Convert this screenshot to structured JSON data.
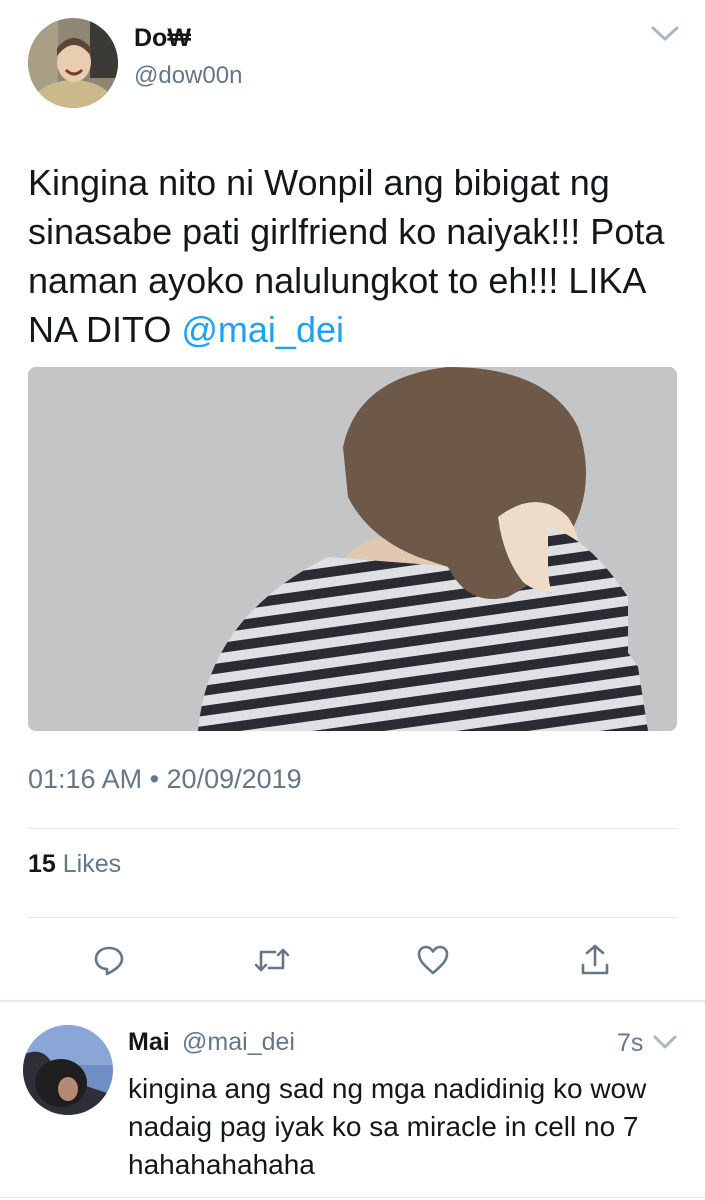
{
  "tweet": {
    "display_name": "Do₩",
    "handle": "@dow00n",
    "text_before_mention": "Kingina nito ni Wonpil ang bibigat ng sinasabe pati girlfriend ko naiyak!!! Pota naman ayoko nalulungkot to eh!!! LIKA NA DITO ",
    "mention": "@mai_dei",
    "timestamp": "01:16 AM • 20/09/2019",
    "likes_count": "15",
    "likes_label": " Likes",
    "icons": [
      "chevron-down-icon",
      "reply-icon",
      "retweet-icon",
      "heart-icon",
      "share-icon"
    ]
  },
  "reply": {
    "display_name": "Mai",
    "handle": "@mai_dei",
    "time": "7s",
    "text": "kingina ang sad ng mga nadidinig ko wow nadaig pag iyak ko sa miracle in cell no 7 hahahahahaha"
  },
  "colors": {
    "link": "#1da1f2",
    "secondary_text": "#657786",
    "divider": "#e1e8ed"
  }
}
